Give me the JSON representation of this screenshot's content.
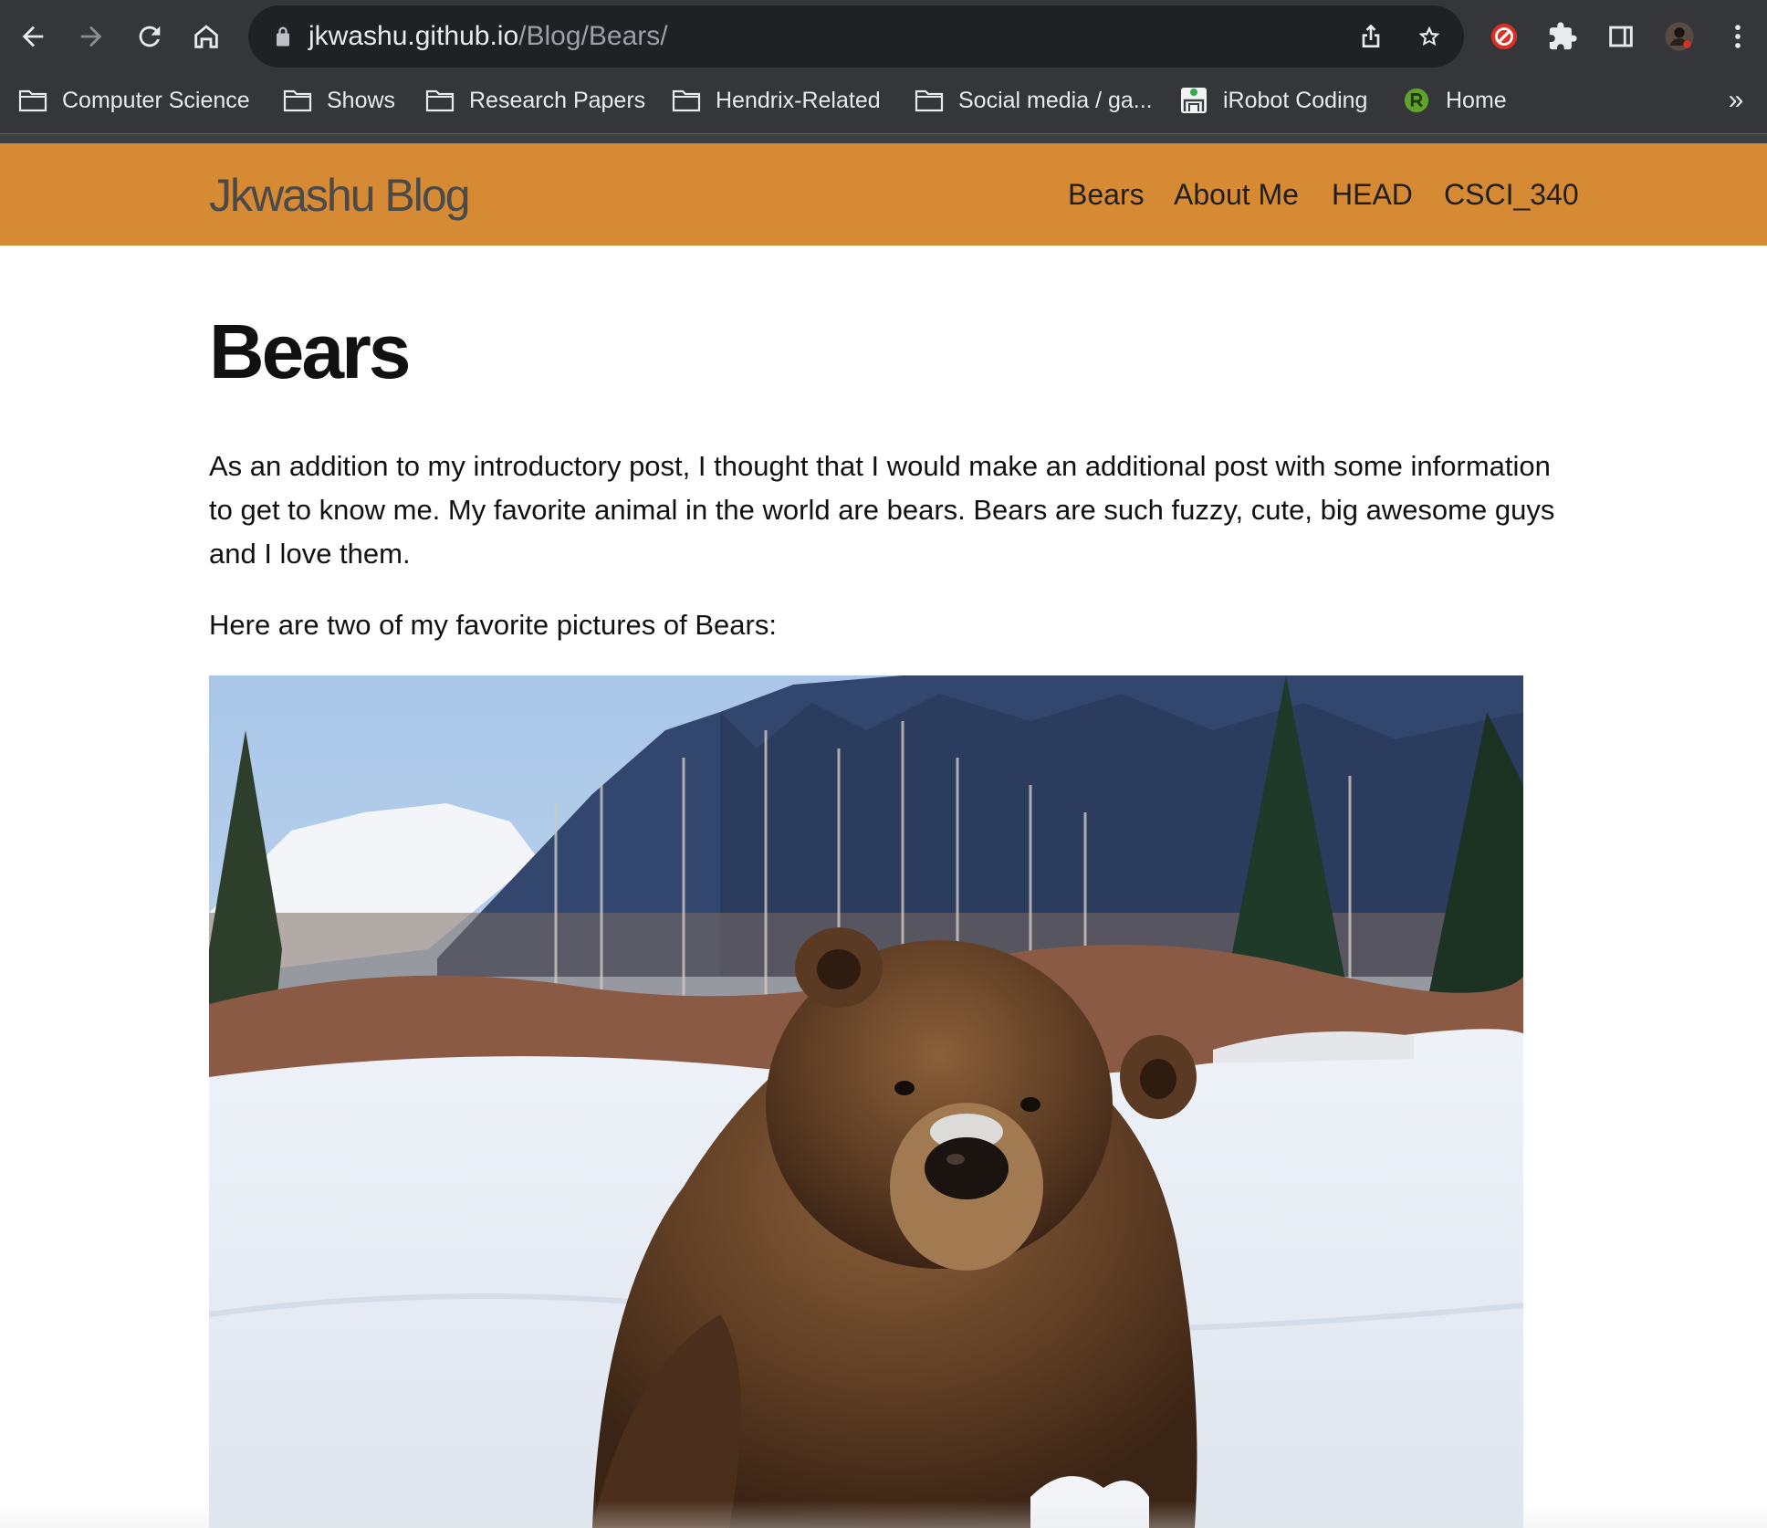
{
  "browser": {
    "url_host": "jkwashu.github.io",
    "url_path": "/Blog/Bears/",
    "icons": {
      "back": "arrow-left-icon",
      "forward": "arrow-right-icon",
      "reload": "reload-icon",
      "home": "home-icon",
      "lock": "lock-icon",
      "share": "share-icon",
      "bookmark": "star-icon",
      "extension_red": "extension-red-icon",
      "extensions": "puzzle-icon",
      "side_panel": "side-panel-icon",
      "profile": "avatar",
      "menu": "kebab-menu-icon"
    },
    "bookmarks": [
      {
        "label": "Computer Science",
        "icon": "folder-icon"
      },
      {
        "label": "Shows",
        "icon": "folder-icon"
      },
      {
        "label": "Research Papers",
        "icon": "folder-icon"
      },
      {
        "label": "Hendrix-Related",
        "icon": "folder-icon"
      },
      {
        "label": "Social media / ga...",
        "icon": "folder-icon"
      },
      {
        "label": "iRobot Coding",
        "icon": "irobot-favicon-icon"
      },
      {
        "label": "Home",
        "icon": "green-favicon-icon"
      }
    ],
    "bookmarks_overflow": "»"
  },
  "site": {
    "brand": "Jkwashu Blog",
    "accent_color": "#d68a33",
    "nav": [
      {
        "label": "Bears"
      },
      {
        "label": "About Me"
      },
      {
        "label": "HEAD"
      },
      {
        "label": "CSCI_340"
      }
    ]
  },
  "post": {
    "title": "Bears",
    "paragraph1": "As an addition to my introductory post, I thought that I would make an additional post with some information to get to know me. My favorite animal in the world are bears. Bears are such fuzzy, cute, big awesome guys and I love them.",
    "paragraph2": "Here are two of my favorite pictures of Bears:",
    "image_subject": "brown bear in snow"
  }
}
